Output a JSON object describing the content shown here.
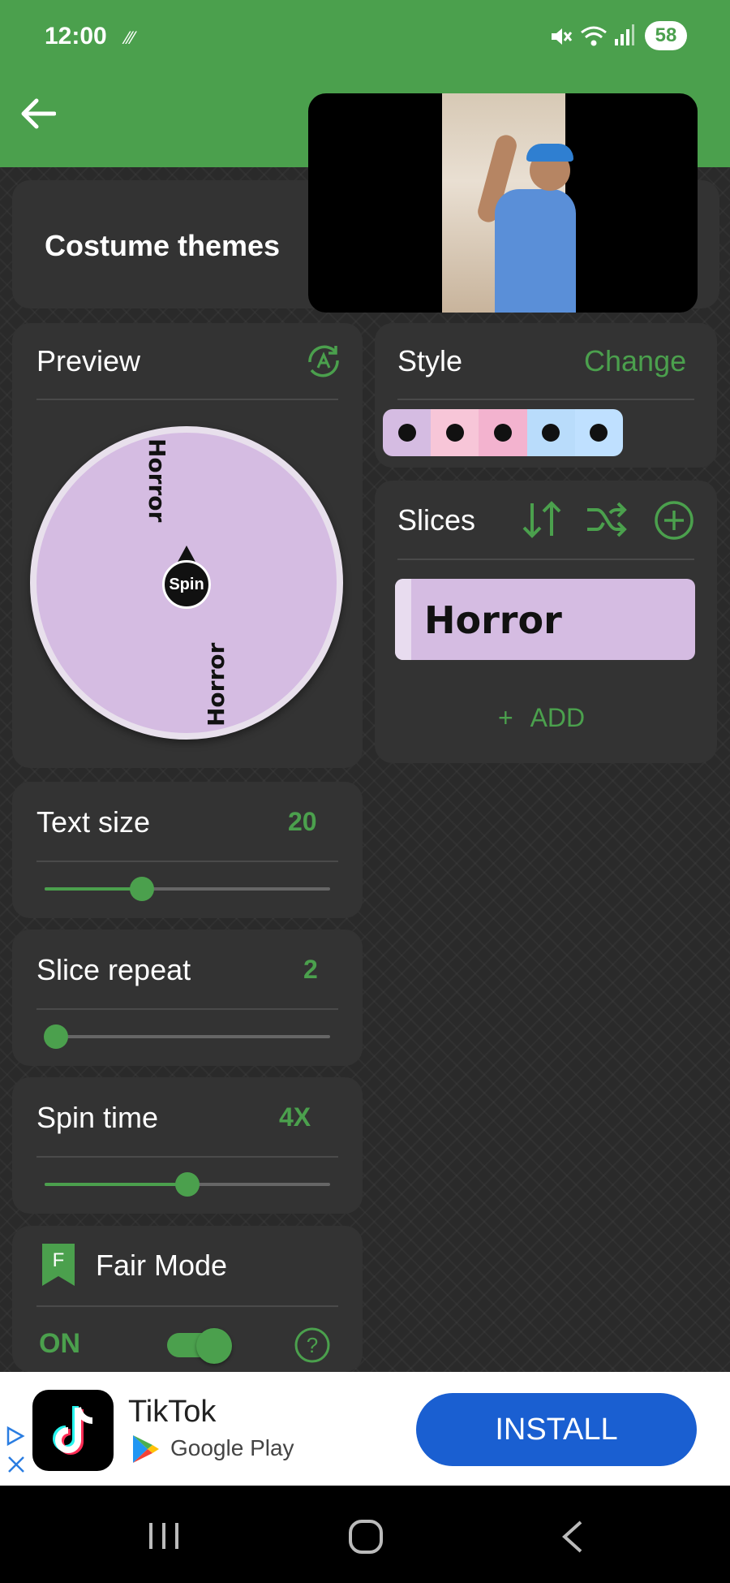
{
  "status_bar": {
    "time": "12:00",
    "battery": "58"
  },
  "header": {
    "title": "Costume themes"
  },
  "preview": {
    "title": "Preview",
    "wheel_labels": [
      "Horror",
      "Horror"
    ],
    "spin_label": "Spin"
  },
  "style": {
    "title": "Style",
    "change_label": "Change",
    "swatch_colors": [
      "#d5bce2",
      "#f7c6d8",
      "#f3b3cf",
      "#b9dcfb",
      "#bfe0ff"
    ]
  },
  "slices": {
    "title": "Slices",
    "items": [
      {
        "label": "Horror",
        "color": "#d5bce2"
      }
    ],
    "add_label": "ADD"
  },
  "settings": {
    "text_size": {
      "label": "Text size",
      "value": "20",
      "level": 0.34
    },
    "slice_repeat": {
      "label": "Slice repeat",
      "value": "2",
      "level": 0.04
    },
    "spin_time": {
      "label": "Spin time",
      "value": "4X",
      "level": 0.5
    }
  },
  "fair_mode": {
    "badge": "F",
    "title": "Fair Mode",
    "state": "ON"
  },
  "ad": {
    "app_name": "TikTok",
    "store": "Google Play",
    "cta": "INSTALL"
  },
  "colors": {
    "accent": "#4ba04d",
    "card": "#333333",
    "install": "#1a5fd1"
  }
}
